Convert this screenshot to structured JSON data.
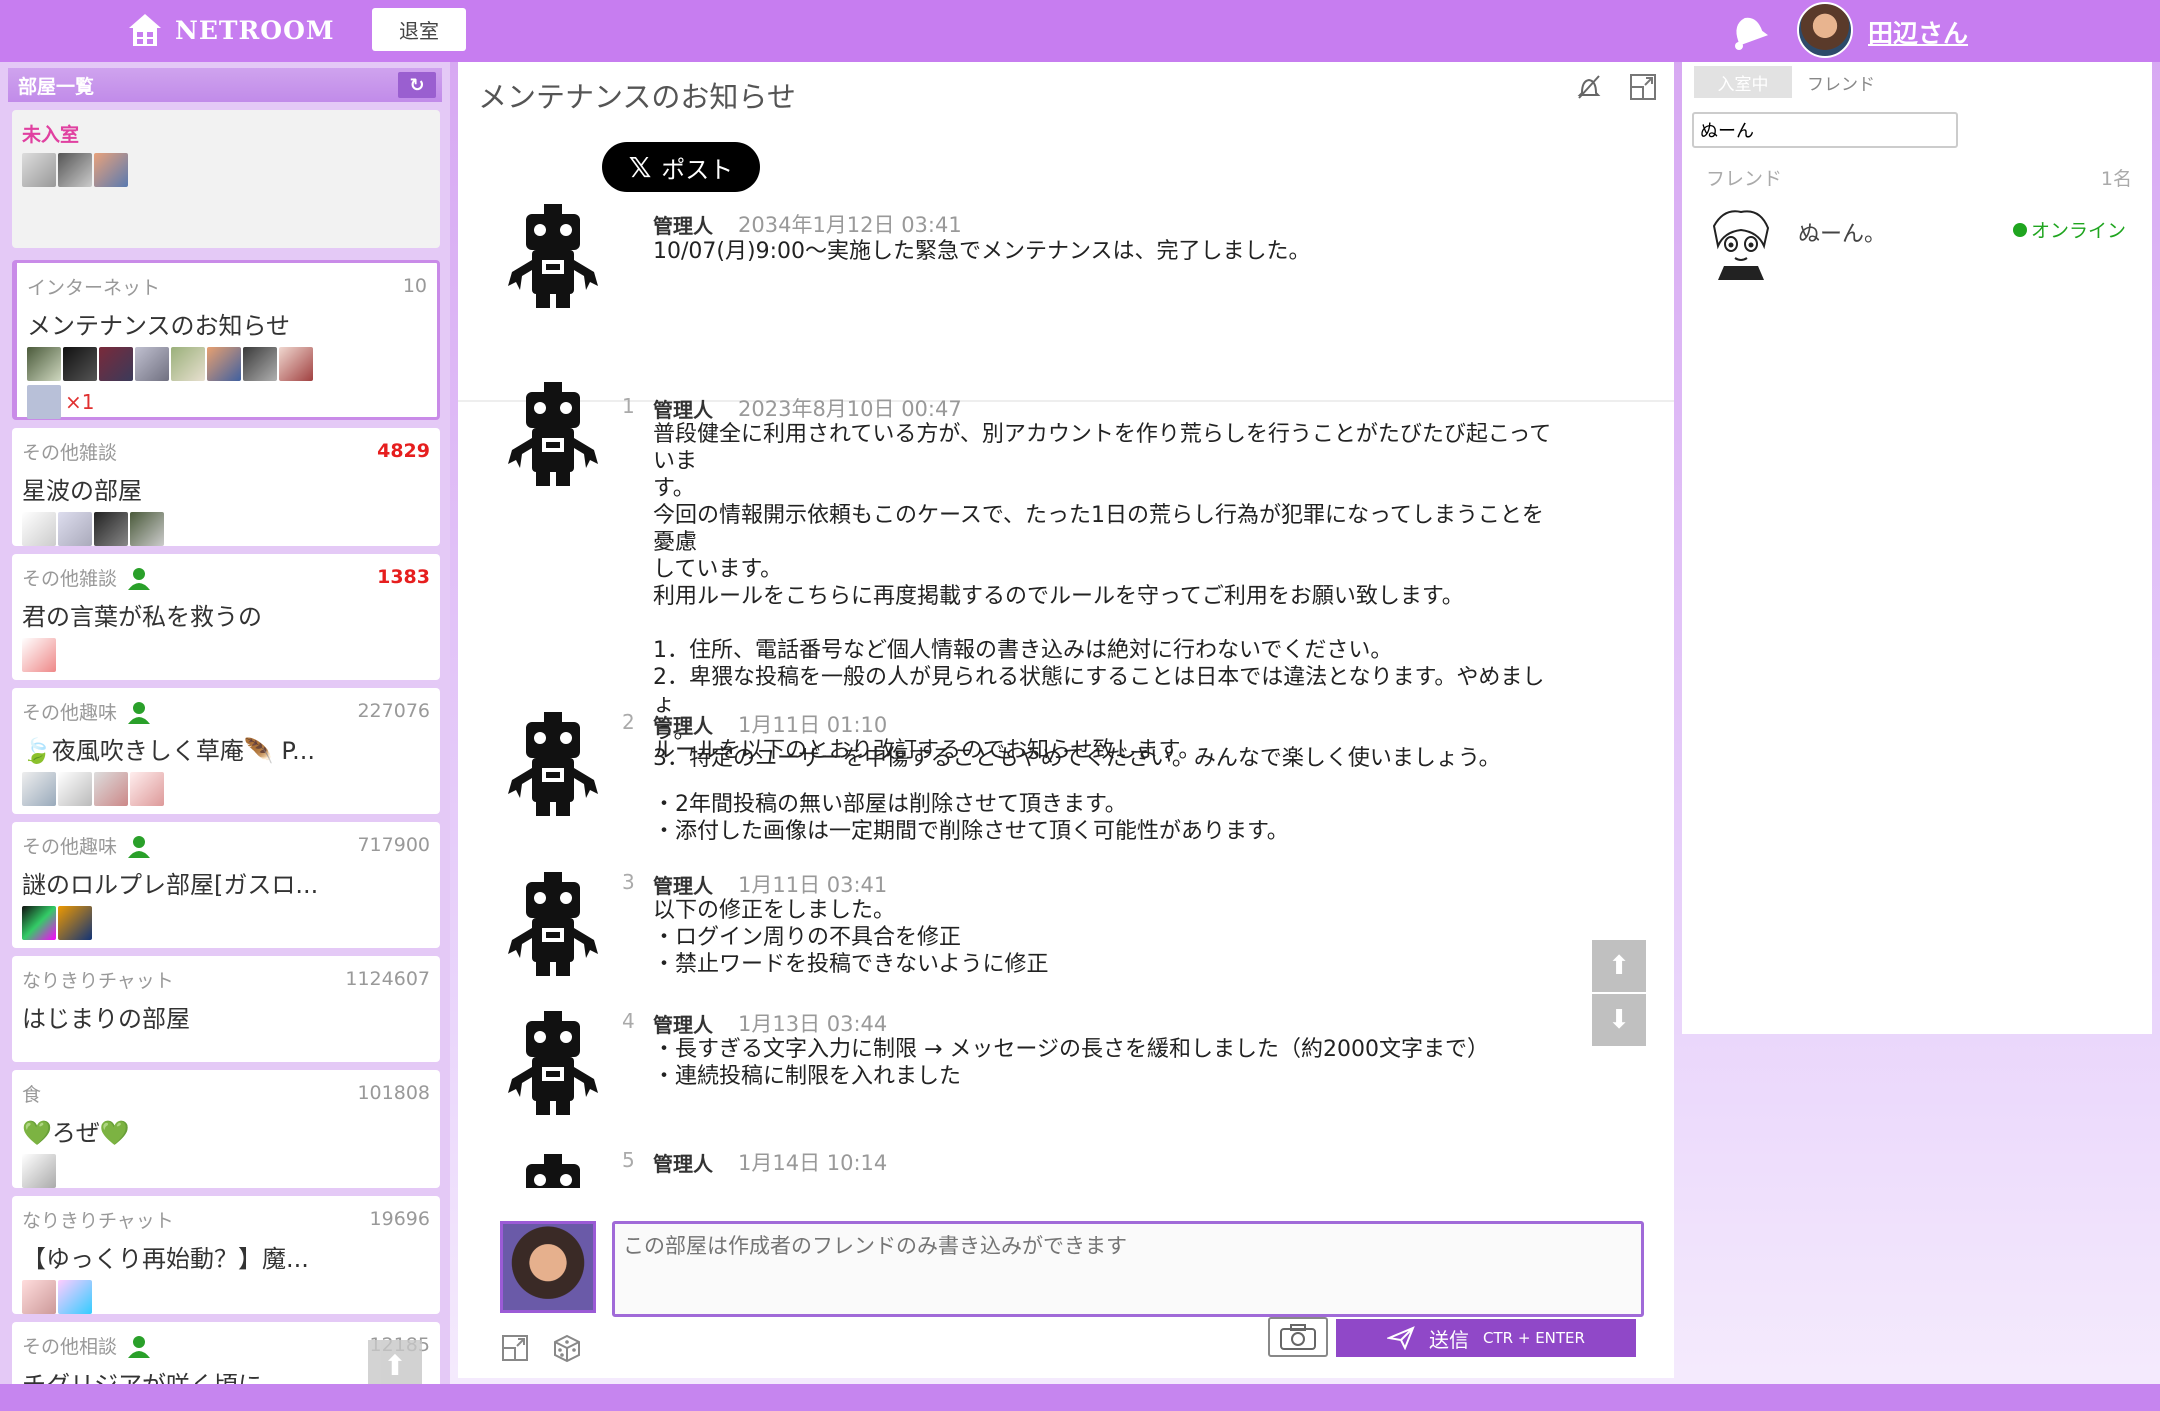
{
  "header": {
    "logo_text": "NETROOM",
    "leave_label": "退室",
    "user_name": "田辺さん",
    "accent_color": "#c77df0"
  },
  "sidebar": {
    "title": "部屋一覧",
    "unentered_label": "未入室",
    "rooms": [
      {
        "category": "インターネット",
        "count": "10",
        "title": "メンテナンスのお知らせ",
        "extra": "×1",
        "active": true
      },
      {
        "category": "その他雑談",
        "count": "4829",
        "title": "星波の部屋",
        "hot": true
      },
      {
        "category": "その他雑談",
        "count": "1383",
        "title": "君の言葉が私を救うの",
        "hot": true,
        "friend_icon": true
      },
      {
        "category": "その他趣味",
        "count": "227076",
        "title": "🍃夜風吹きしく草庵🪶 P...",
        "friend_icon": true
      },
      {
        "category": "その他趣味",
        "count": "717900",
        "title": "謎のロルプレ部屋[ガスロ...",
        "friend_icon": true
      },
      {
        "category": "なりきりチャット",
        "count": "1124607",
        "title": "はじまりの部屋"
      },
      {
        "category": "食",
        "count": "101808",
        "title": "💚ろぜ💚"
      },
      {
        "category": "なりきりチャット",
        "count": "19696",
        "title": "【ゆっくり再始動？】魔..."
      },
      {
        "category": "その他相談",
        "count": "12185",
        "title": "チグリジアが咲く頃に。",
        "friend_icon": true
      }
    ]
  },
  "room": {
    "title": "メンテナンスのお知らせ",
    "post_label": "ポスト",
    "pinned": {
      "author": "管理人",
      "time": "2034年1月12日 03:41",
      "body": [
        "10/07(月)9:00〜実施した緊急でメンテナンスは、完了しました。"
      ]
    },
    "messages": [
      {
        "num": "1",
        "author": "管理人",
        "time": "2023年8月10日 00:47",
        "body": [
          "普段健全に利用されている方が、別アカウントを作り荒らしを行うことがたびたび起こっていま",
          "す。",
          "今回の情報開示依頼もこのケースで、たった1日の荒らし行為が犯罪になってしまうことを憂慮",
          "しています。",
          "利用ルールをこちらに再度掲載するのでルールを守ってご利用をお願い致します。",
          "",
          "1．住所、電話番号など個人情報の書き込みは絶対に行わないでください。",
          "2．卑猥な投稿を一般の人が見られる状態にすることは日本では違法となります。やめましょ",
          "う。",
          "3．特定のユーザーを中傷することもやめてください。みんなで楽しく使いましょう。"
        ]
      },
      {
        "num": "2",
        "author": "管理人",
        "time": "1月11日 01:10",
        "body": [
          "ルールを以下のとおり改訂するのでお知らせ致します。",
          "",
          "・2年間投稿の無い部屋は削除させて頂きます。",
          "・添付した画像は一定期間で削除させて頂く可能性があります。"
        ]
      },
      {
        "num": "3",
        "author": "管理人",
        "time": "1月11日 03:41",
        "body": [
          "以下の修正をしました。",
          "・ログイン周りの不具合を修正",
          "・禁止ワードを投稿できないように修正"
        ]
      },
      {
        "num": "4",
        "author": "管理人",
        "time": "1月13日 03:44",
        "body": [
          "・長すぎる文字入力に制限 → メッセージの長さを緩和しました（約2000文字まで）",
          "・連続投稿に制限を入れました"
        ]
      },
      {
        "num": "5",
        "author": "管理人",
        "time": "1月14日 10:14",
        "body": []
      }
    ],
    "input_placeholder": "この部屋は作成者のフレンドのみ書き込みができます",
    "send_label": "送信",
    "send_hint": "CTR + ENTER"
  },
  "right_panel": {
    "tab_in_room": "入室中",
    "tab_friend": "フレンド",
    "search_value": "ぬーん",
    "section_label": "フレンド",
    "section_count": "1名",
    "friend": {
      "name": "ぬーん。",
      "status": "オンライン",
      "status_color": "#1fa51f"
    }
  }
}
